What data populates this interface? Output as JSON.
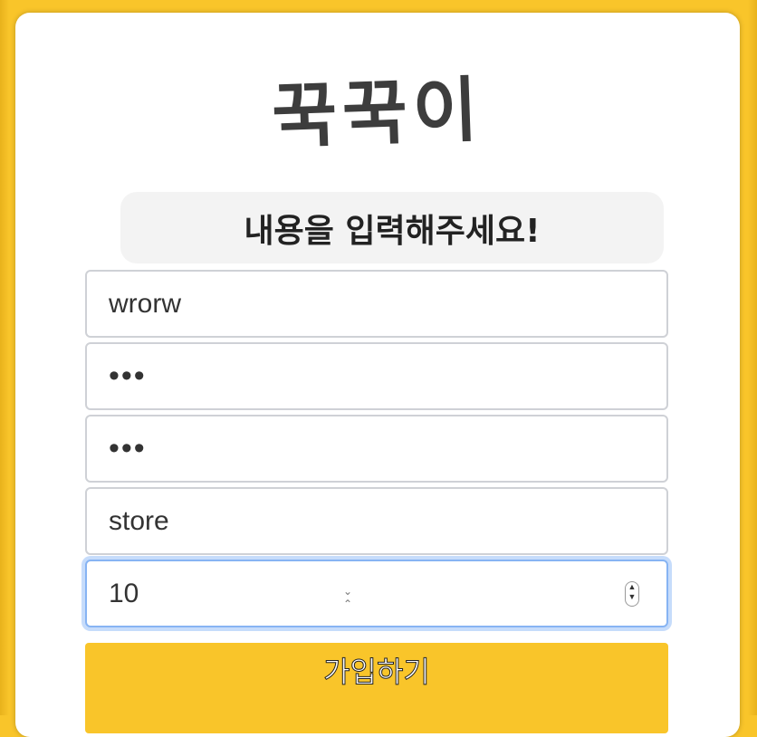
{
  "app": {
    "logo_text": "꾹꾹이",
    "notice": "내용을 입력해주세요!"
  },
  "form": {
    "fields": [
      {
        "name": "username",
        "value": "wrorw"
      },
      {
        "name": "password",
        "value": "•••"
      },
      {
        "name": "password-confirm",
        "value": "•••"
      },
      {
        "name": "store",
        "value": "store"
      },
      {
        "name": "number",
        "value": "10"
      }
    ],
    "submit_label": "가입하기"
  },
  "colors": {
    "background": "#f9c52a",
    "button": "#f9c52a",
    "focus_border": "#87b4f3"
  }
}
